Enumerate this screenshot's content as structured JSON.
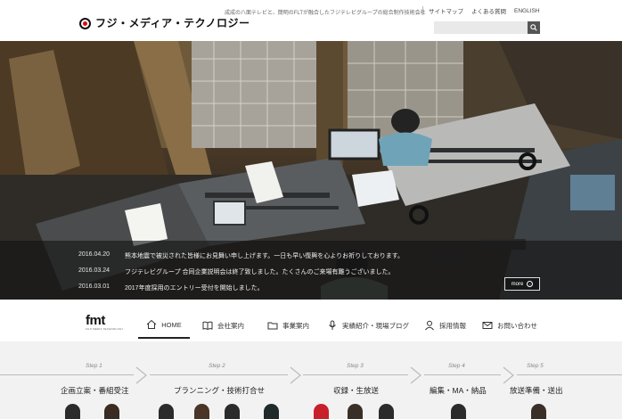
{
  "header": {
    "logo_text": "フジ・メディア・テクノロジー",
    "tagline": "成成の八面テレビと、簡明のFLTが融合したフジテレビグループの総合制作技術会社",
    "utility_links": [
      {
        "label": "サイトマップ"
      },
      {
        "label": "よくある質問"
      },
      {
        "label": "ENGLISH"
      }
    ],
    "search": {
      "placeholder": "",
      "value": ""
    }
  },
  "news": {
    "items": [
      {
        "date": "2016.04.20",
        "text": "熊本地震で被災された皆様にお見舞い申し上げます。一日も早い復興を心よりお祈りしております。"
      },
      {
        "date": "2016.03.24",
        "text": "フジテレビグループ 合同企業説明会は終了致しました。たくさんのご来場有難うございました。"
      },
      {
        "date": "2016.03.01",
        "text": "2017年度採用のエントリー受付を開始しました。"
      }
    ],
    "more_label": "more"
  },
  "nav": {
    "logo_text": "fmt",
    "logo_sub": "FUJI MEDIA TECHNOLOGY",
    "items": [
      {
        "label": "HOME",
        "icon": "home-icon",
        "active": true
      },
      {
        "label": "会社案内",
        "icon": "book-icon",
        "active": false
      },
      {
        "label": "事業案内",
        "icon": "folder-icon",
        "active": false
      },
      {
        "label": "実績紹介・現場ブログ",
        "icon": "mic-icon",
        "active": false
      },
      {
        "label": "採用情報",
        "icon": "person-icon",
        "active": false
      },
      {
        "label": "お問い合わせ",
        "icon": "mail-icon",
        "active": false
      }
    ]
  },
  "steps": [
    {
      "label": "Step 1",
      "title": "企画立案・番組受注"
    },
    {
      "label": "Step 2",
      "title": "プランニング・技術打合せ"
    },
    {
      "label": "Step 3",
      "title": "収録・生放送"
    },
    {
      "label": "Step 4",
      "title": "編集・MA・納品"
    },
    {
      "label": "Step 5",
      "title": "放送準備・送出"
    }
  ],
  "colors": {
    "brand_red": "#e60012",
    "news_overlay": "#141414",
    "steps_bg": "#f2f2f2"
  }
}
